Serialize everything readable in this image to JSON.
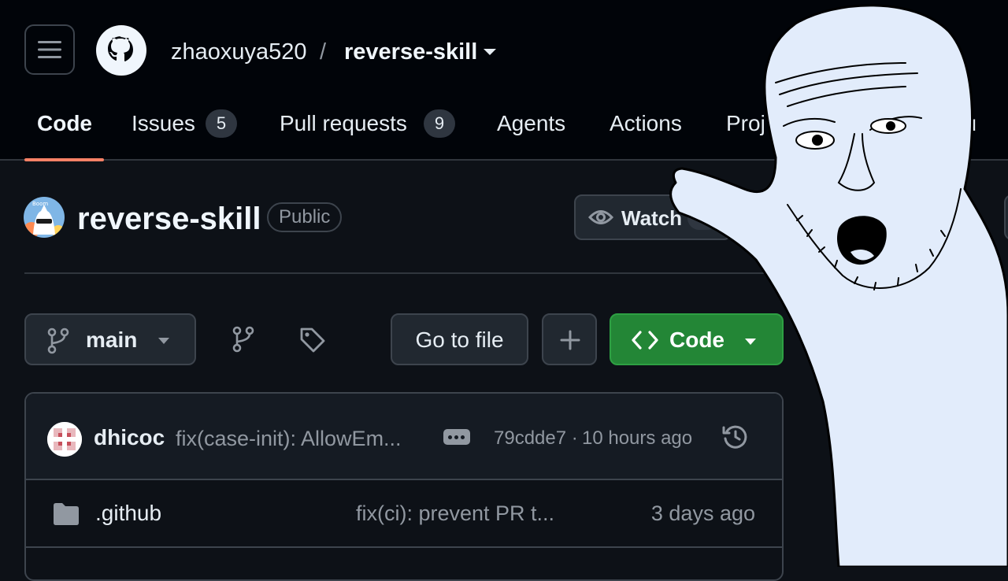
{
  "header": {
    "owner": "zhaoxuya520",
    "separator": "/",
    "repo": "reverse-skill"
  },
  "tabs": [
    {
      "label": "Code",
      "active": true
    },
    {
      "label": "Issues",
      "count": "5"
    },
    {
      "label": "Pull requests",
      "count": "9"
    },
    {
      "label": "Agents"
    },
    {
      "label": "Actions"
    },
    {
      "label": "Proj"
    },
    {
      "label": "nd qu"
    }
  ],
  "repo_header": {
    "title": "reverse-skill",
    "visibility": "Public",
    "watch_label": "Watch",
    "avatar_text": "Boom"
  },
  "toolbar": {
    "branch": "main",
    "go_to_file": "Go to file",
    "code_label": "Code"
  },
  "latest_commit": {
    "author": "dhicoc",
    "message": "fix(case-init): AllowEm...",
    "hash": "79cdde7",
    "separator": "·",
    "time": "10 hours ago"
  },
  "files": [
    {
      "name": ".github",
      "type": "folder",
      "message": "fix(ci): prevent PR t...",
      "time": "3 days ago"
    }
  ],
  "colors": {
    "accent_underline": "#f78166",
    "code_button": "#238636",
    "background": "#0d1117",
    "header_background": "#010409",
    "meme_fill": "#e2ecfb"
  },
  "icons": {
    "menu": "hamburger-icon",
    "logo": "github-logo-icon",
    "watch": "eye-icon",
    "branch": "git-branch-icon",
    "tags": "tag-icon",
    "history": "history-icon",
    "folder": "folder-icon"
  }
}
